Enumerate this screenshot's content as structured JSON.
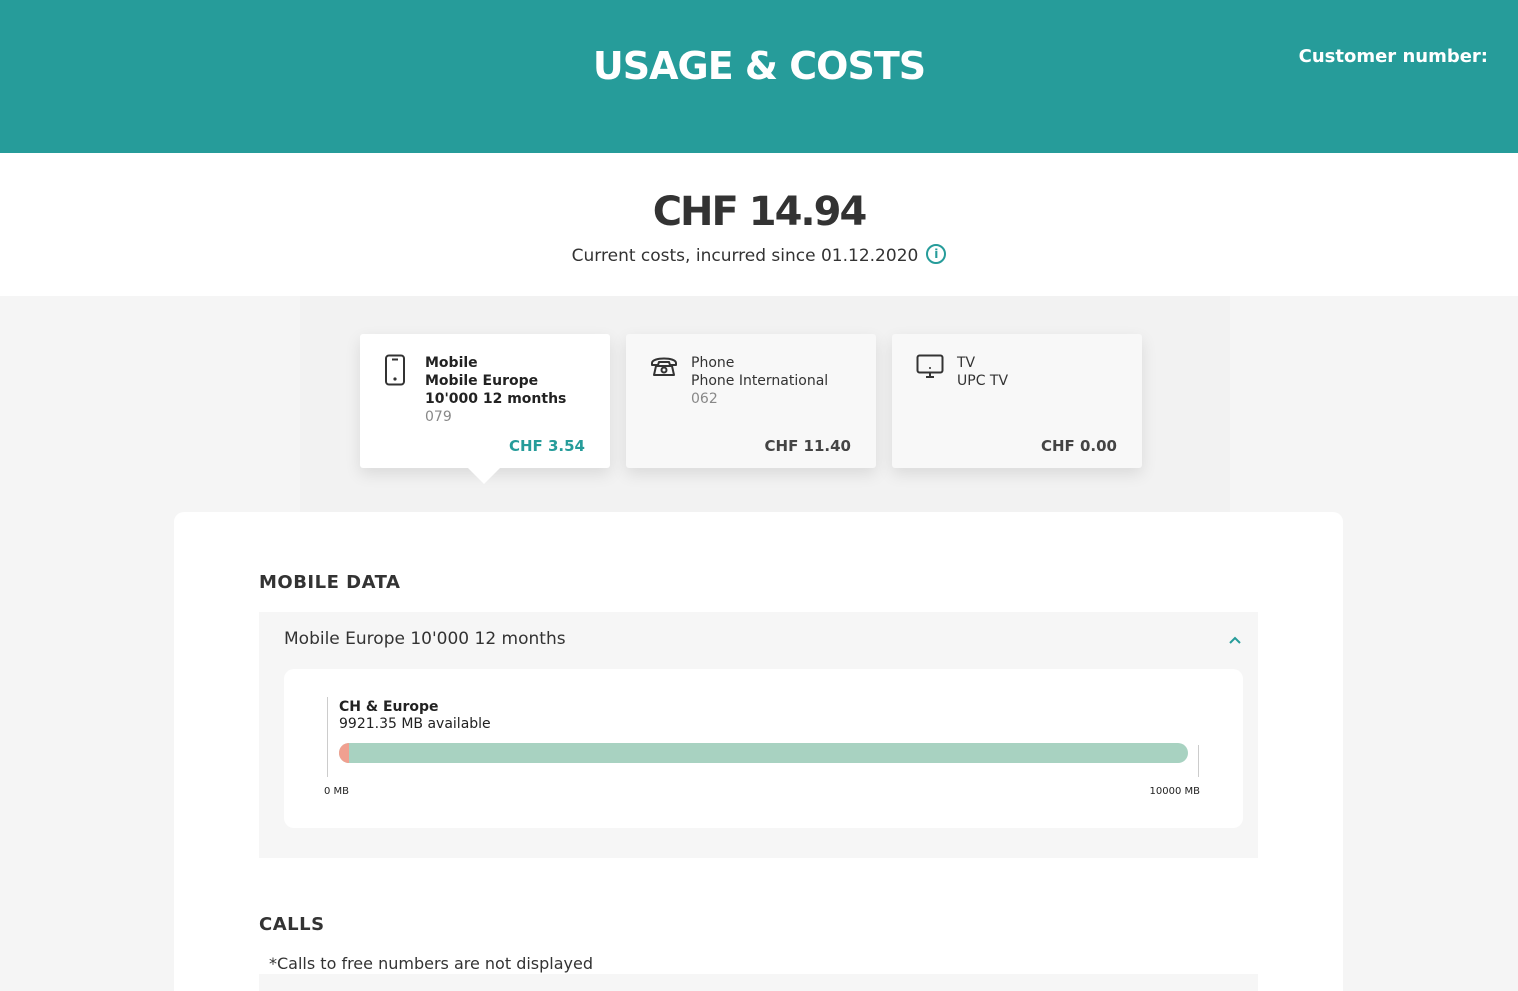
{
  "header": {
    "title": "USAGE & COSTS",
    "customer_label": "Customer number:"
  },
  "summary": {
    "total": "CHF 14.94",
    "since_text": "Current costs, incurred since 01.12.2020",
    "info_icon": "i"
  },
  "tiles": [
    {
      "icon": "mobile-phone-icon",
      "line1": "Mobile",
      "line2": "Mobile Europe",
      "line3": "10'000 12 months",
      "number": "079",
      "price": "CHF 3.54",
      "active": true
    },
    {
      "icon": "telephone-icon",
      "line1": "Phone",
      "line2": "Phone International",
      "number": "062",
      "price": "CHF 11.40",
      "active": false
    },
    {
      "icon": "tv-icon",
      "line1": "TV",
      "line2": "UPC TV",
      "price": "CHF 0.00",
      "active": false
    }
  ],
  "mobile_data": {
    "section_title": "MOBILE DATA",
    "plan_label": "Mobile Europe 10'000 12 months",
    "chevron": "^",
    "usage": {
      "name": "CH & Europe",
      "available": "9921.35 MB available",
      "used_mb": 78.65,
      "total_mb": 10000,
      "min_label": "0 MB",
      "max_label": "10000 MB"
    }
  },
  "calls": {
    "section_title": "CALLS",
    "note": "*Calls to free numbers are not displayed"
  },
  "colors": {
    "brand_teal": "#269c9a",
    "bar_available": "#a8d2c1",
    "bar_used": "#f0a090"
  }
}
